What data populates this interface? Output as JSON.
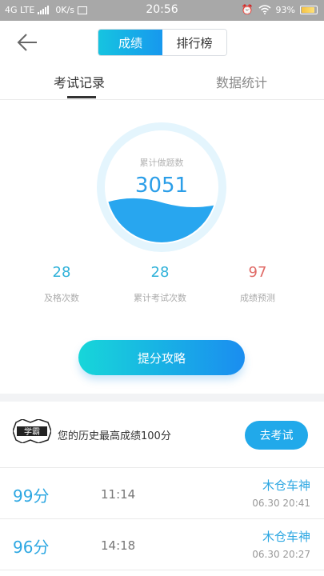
{
  "status_bar": {
    "network": "4G LTE",
    "speed": "0K/s",
    "time": "20:56",
    "battery": "93%"
  },
  "header": {
    "segments": [
      "成绩",
      "排行榜"
    ],
    "active_segment": "成绩"
  },
  "tabs": [
    "考试记录",
    "数据统计"
  ],
  "gauge": {
    "label": "累计做题数",
    "value": "3051"
  },
  "stats": [
    {
      "value": "28",
      "label": "及格次数",
      "color": "#2fb1d9"
    },
    {
      "value": "28",
      "label": "累计考试次数",
      "color": "#2fb1d9"
    },
    {
      "value": "97",
      "label": "成绩预测",
      "color": "#e06a66"
    }
  ],
  "cta": {
    "label": "提分攻略"
  },
  "best": {
    "badge_text": "学霸",
    "text": "您的历史最高成绩100分",
    "button": "去考试"
  },
  "records": [
    {
      "score": "99分",
      "duration": "11:14",
      "name": "木仓车神",
      "date": "06.30 20:41"
    },
    {
      "score": "96分",
      "duration": "14:18",
      "name": "木仓车神",
      "date": "06.30 20:27"
    }
  ]
}
